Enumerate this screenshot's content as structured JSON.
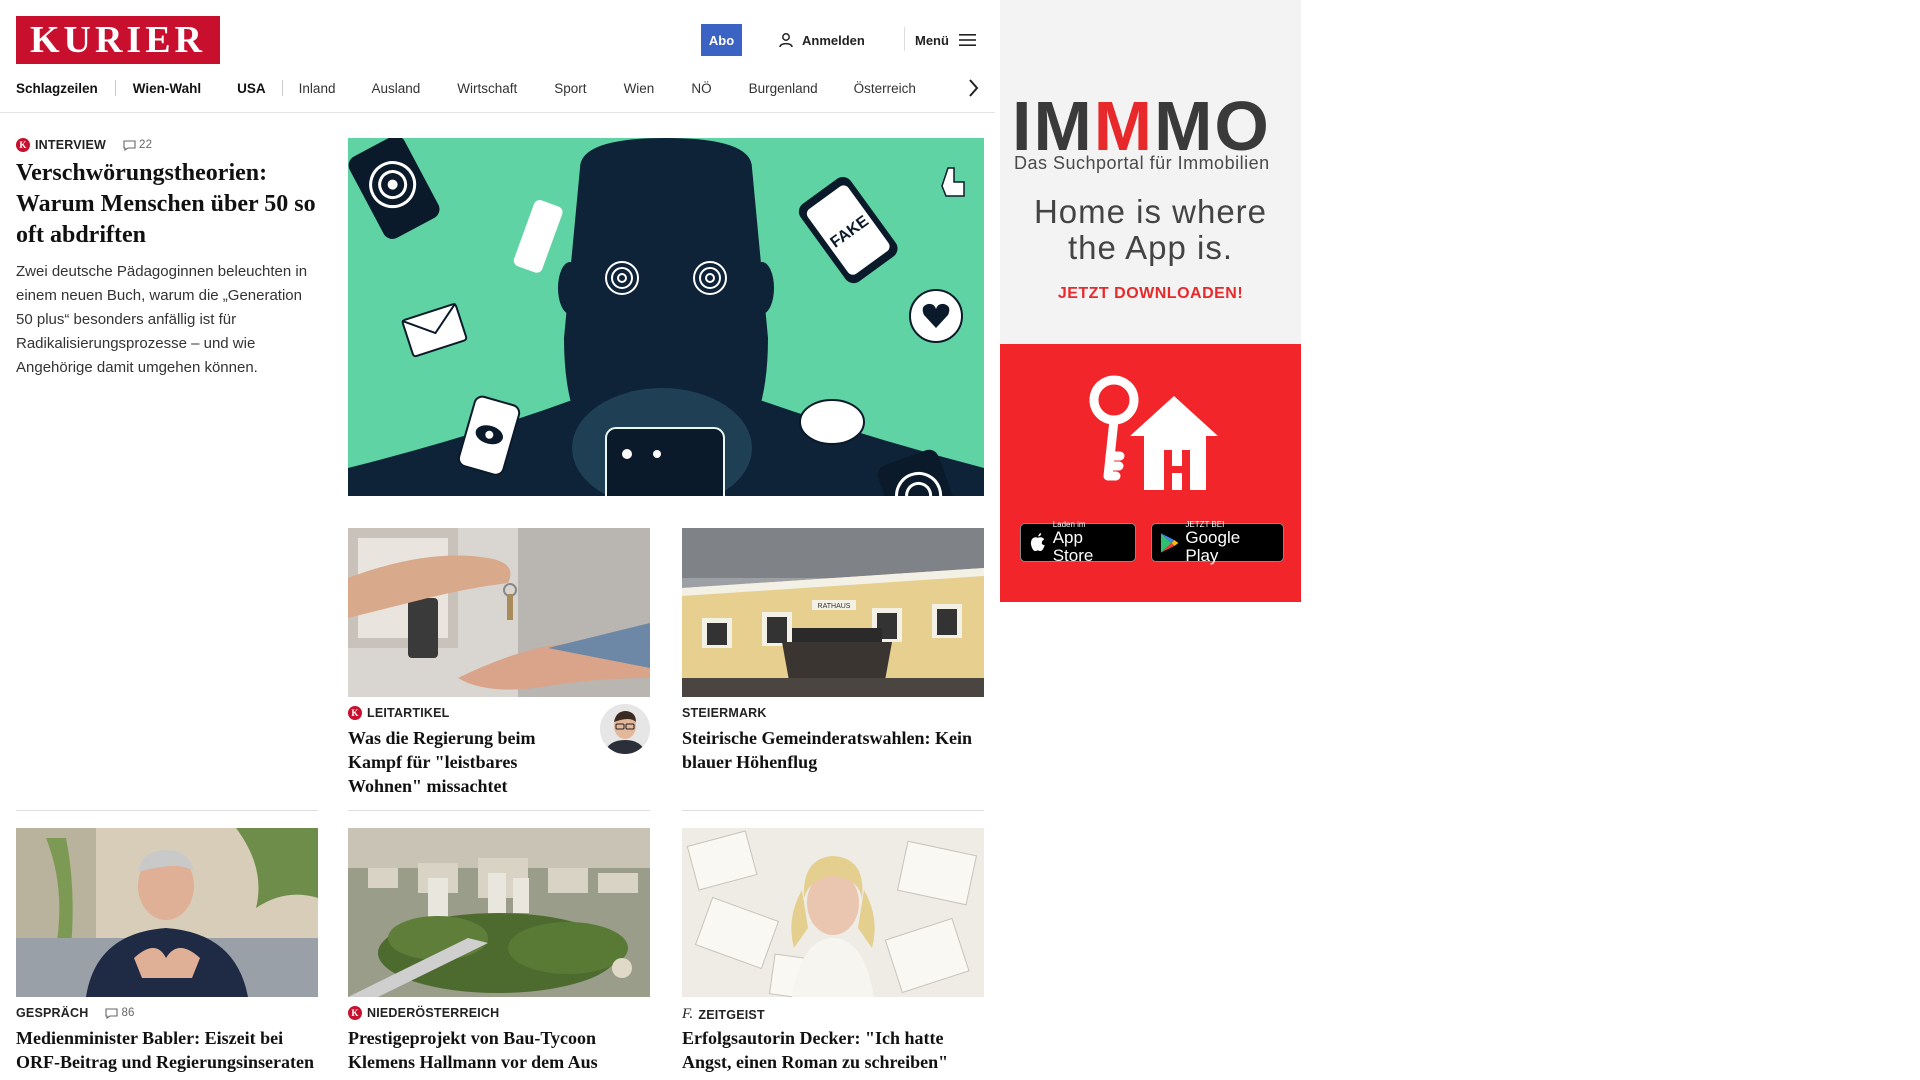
{
  "header": {
    "logo": "KURIER",
    "abo_label": "Abo",
    "login_label": "Anmelden",
    "menu_label": "Menü"
  },
  "nav": {
    "items": [
      "Schlagzeilen",
      "Wien-Wahl",
      "USA",
      "Inland",
      "Ausland",
      "Wirtschaft",
      "Sport",
      "Wien",
      "NÖ",
      "Burgenland",
      "Österreich"
    ]
  },
  "lead": {
    "kicker": "Interview",
    "comments": "22",
    "headline": "Verschwörungstheorien: Warum Menschen über 50 so oft abdriften",
    "text": "Zwei deutsche Pädagoginnen beleuchten in einem neuen Buch, warum die „Generation 50 plus“ besonders anfällig ist für Radikalisierungsprozesse – und wie Angehörige damit umgehen können.",
    "image_text": "FAKE"
  },
  "articles": [
    {
      "kicker": "Leitartikel",
      "headline": "Was die Regierung beim Kampf für \"leistbares Wohnen\" missachtet"
    },
    {
      "kicker": "Steiermark",
      "headline": "Steirische Gemeinderatswahlen: Kein blauer Höhenflug",
      "image_text": "RATHAUS"
    },
    {
      "kicker": "Gespräch",
      "comments": "86",
      "headline": "Medienminister Babler: Eiszeit bei ORF-Beitrag und Regierungsinseraten"
    },
    {
      "kicker": "Niederösterreich",
      "headline": "Prestigeprojekt von Bau-Tycoon Klemens Hallmann vor dem Aus"
    },
    {
      "kicker": "Zeitgeist",
      "headline": "Erfolgsautorin Decker: \"Ich hatte Angst, einen Roman zu schreiben\""
    }
  ],
  "ad": {
    "brand_parts": [
      "IM",
      "M",
      "MO"
    ],
    "subtitle": "Das Suchportal für Immobilien",
    "claim_line1": "Home is where",
    "claim_line2": "the App is.",
    "cta": "JETZT DOWNLOADEN!",
    "appstore_small": "Laden im",
    "appstore_big": "App Store",
    "googleplay_small": "JETZT BEI",
    "googleplay_big": "Google Play"
  },
  "colors": {
    "brand_red": "#c8102e",
    "abo_blue": "#3b63c4",
    "ad_red": "#f2262a",
    "lead_image_green": "#5fd3a3"
  }
}
